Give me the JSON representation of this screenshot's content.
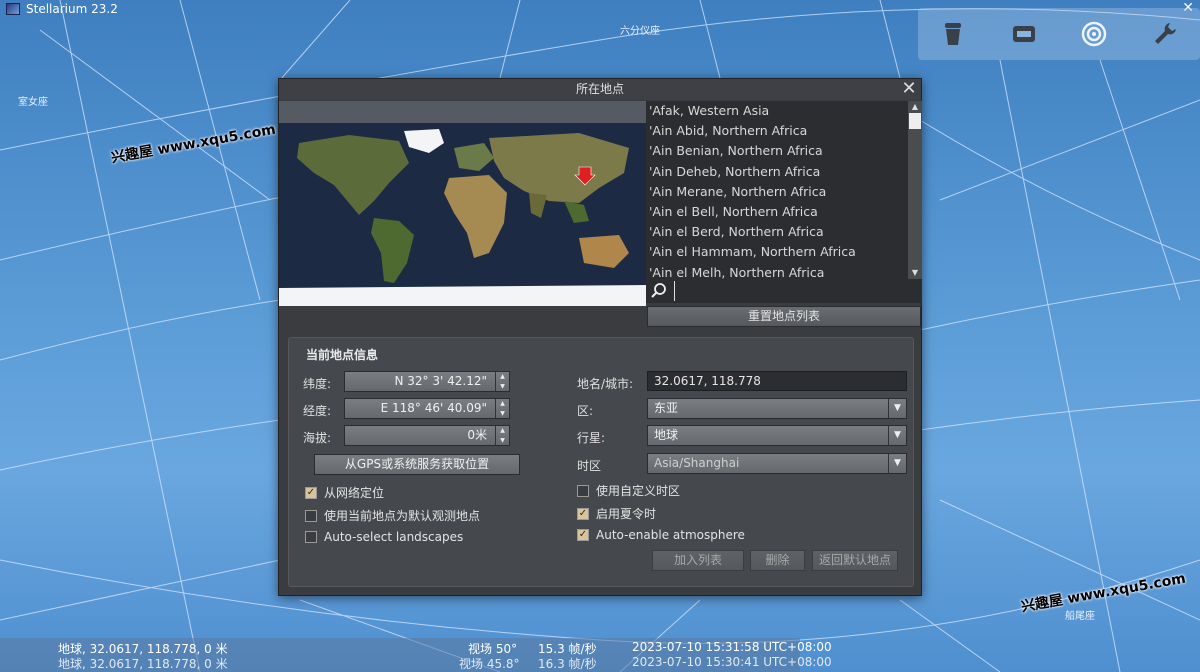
{
  "app": {
    "title": "Stellarium 23.2",
    "close_glyph": "✕"
  },
  "sky_labels": {
    "top": "六分仪座",
    "left": "室女座",
    "right_bottom": "船尾座"
  },
  "toolbar": {
    "icons": [
      "observer-icon",
      "window-icon",
      "target-icon",
      "wrench-icon"
    ]
  },
  "watermark": "兴趣屋 www.xqu5.com",
  "dialog": {
    "title": "所在地点",
    "close_glyph": "✕",
    "locations": [
      "'Afak, Western Asia",
      "'Ain Abid, Northern Africa",
      "'Ain Benian, Northern Africa",
      "'Ain Deheb, Northern Africa",
      "'Ain Merane, Northern Africa",
      "'Ain el Bell, Northern Africa",
      "'Ain el Berd, Northern Africa",
      "'Ain el Hammam, Northern Africa",
      "'Ain el Melh, Northern Africa"
    ],
    "search_value": "",
    "reset_list_label": "重置地点列表",
    "info": {
      "group_title": "当前地点信息",
      "latitude_label": "纬度:",
      "latitude_value": "N 32° 3' 42.12\"",
      "longitude_label": "经度:",
      "longitude_value": "E 118° 46' 40.09\"",
      "altitude_label": "海拔:",
      "altitude_value": "0米",
      "gps_button": "从GPS或系统服务获取位置",
      "checks_left": [
        {
          "label": "从网络定位",
          "checked": true
        },
        {
          "label": "使用当前地点为默认观测地点",
          "checked": false
        },
        {
          "label": "Auto-select landscapes",
          "checked": false
        }
      ],
      "name_label": "地名/城市:",
      "name_value": "32.0617, 118.778",
      "region_label": "区:",
      "region_value": "东亚",
      "planet_label": "行星:",
      "planet_value": "地球",
      "timezone_label": "时区",
      "timezone_value": "Asia/Shanghai",
      "checks_right": [
        {
          "label": "使用自定义时区",
          "checked": false
        },
        {
          "label": "启用夏令时",
          "checked": true
        },
        {
          "label": "Auto-enable atmosphere",
          "checked": true
        }
      ],
      "add_button": "加入列表",
      "delete_button": "删除",
      "restore_button": "返回默认地点"
    }
  },
  "status": {
    "row1": {
      "location": "地球, 32.0617, 118.778, 0 米",
      "fov": "视场 50°",
      "fps": "15.3 帧/秒",
      "datetime": "2023-07-10 15:31:58 UTC+08:00"
    },
    "row2": {
      "location": "地球, 32.0617, 118.778, 0 米",
      "fov": "视场 45.8°",
      "fps": "16.3 帧/秒",
      "datetime": "2023-07-10 15:30:41 UTC+08:00"
    }
  },
  "colors": {
    "sky": "#5a9bd6",
    "dialog_bg": "#3a3c40",
    "marker": "#e02020"
  }
}
